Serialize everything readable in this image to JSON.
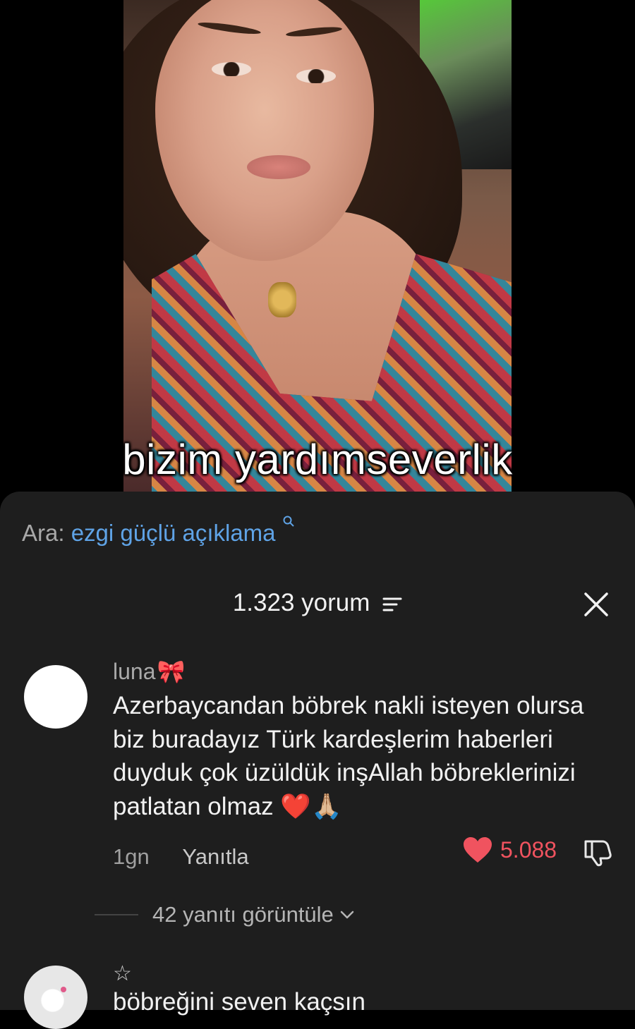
{
  "video": {
    "caption": "bizim yardımseverlik"
  },
  "search": {
    "label": "Ara:",
    "term": "ezgi güçlü açıklama"
  },
  "comments_header": {
    "count_label": "1.323 yorum"
  },
  "comments": [
    {
      "username": "luna",
      "username_emoji": "🎀",
      "text": "Azerbaycandan böbrek nakli isteyen olursa biz buradayız Türk kardeşlerim haberleri duyduk çok üzüldük inşAllah böbreklerinizi patlatan olmaz ❤️🙏🏼",
      "time": "1gn",
      "reply_label": "Yanıtla",
      "likes": "5.088",
      "view_replies": "42 yanıtı görüntüle"
    },
    {
      "username": "☆",
      "text": "böbreğini seven kaçsın"
    }
  ],
  "colors": {
    "sheet_bg": "#1e1e1e",
    "link_blue": "#5fa3e6",
    "like_red": "#f0535f"
  }
}
